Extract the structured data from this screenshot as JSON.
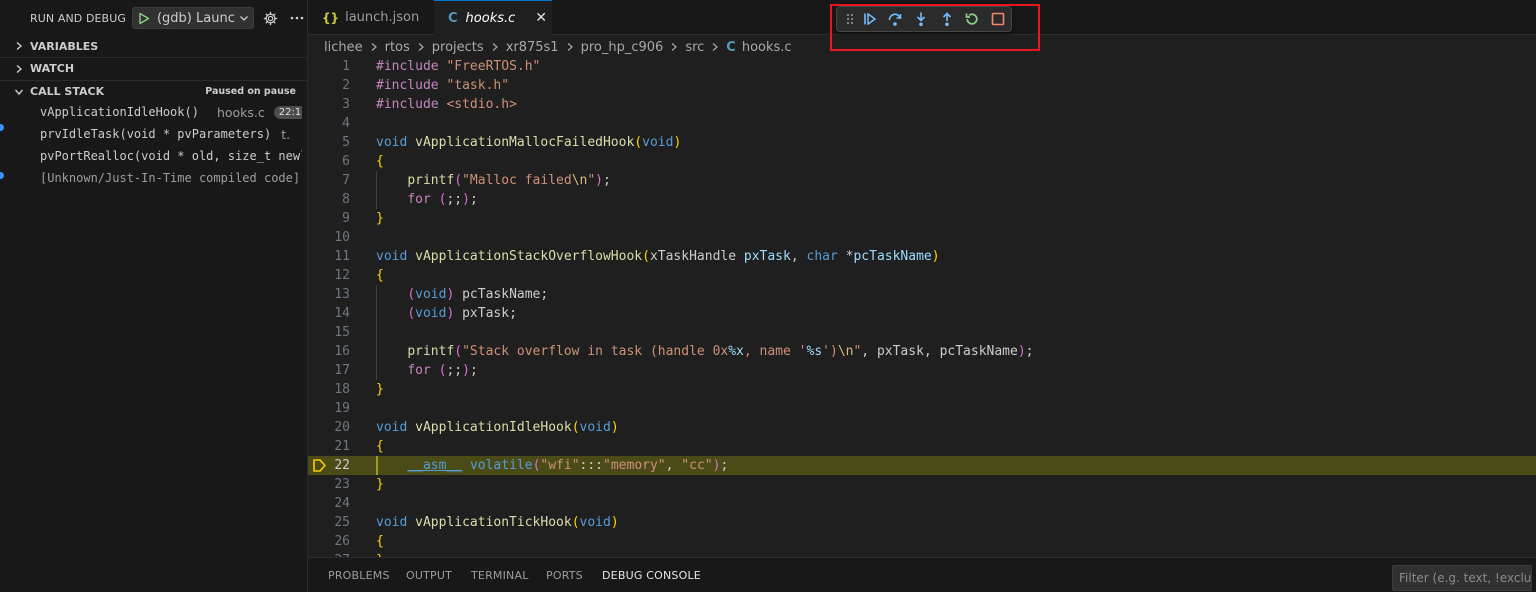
{
  "sidebar": {
    "title": "RUN AND DEBUG",
    "launch_config": "(gdb) Launch",
    "sections": {
      "variables": "VARIABLES",
      "watch": "WATCH",
      "call_stack": "CALL STACK"
    },
    "paused_status": "Paused on pause",
    "call_stack": [
      {
        "name": "vApplicationIdleHook()",
        "file": "hooks.c",
        "badge": "22:1"
      },
      {
        "name": "prvIdleTask(void * pvParameters)",
        "file": "t."
      },
      {
        "name": "pvPortRealloc(void * old, size_t newlen)"
      },
      {
        "name": "[Unknown/Just-In-Time compiled code]"
      }
    ]
  },
  "tabs": [
    {
      "label": "launch.json",
      "icon": "json-braces-icon"
    },
    {
      "label": "hooks.c",
      "icon": "c-file-icon",
      "active": true
    }
  ],
  "breadcrumb": [
    "lichee",
    "rtos",
    "projects",
    "xr875s1",
    "pro_hp_c906",
    "src",
    "hooks.c"
  ],
  "editor": {
    "current_line": 22
  },
  "panel": {
    "tabs": [
      "PROBLEMS",
      "OUTPUT",
      "TERMINAL",
      "PORTS",
      "DEBUG CONSOLE"
    ],
    "active_tab": "DEBUG CONSOLE",
    "filter_placeholder": "Filter (e.g. text, !exclude)"
  },
  "colors": {
    "accent": "#0078d4",
    "highlight_box": "#e8161f",
    "current_line": "#4b4b18"
  }
}
